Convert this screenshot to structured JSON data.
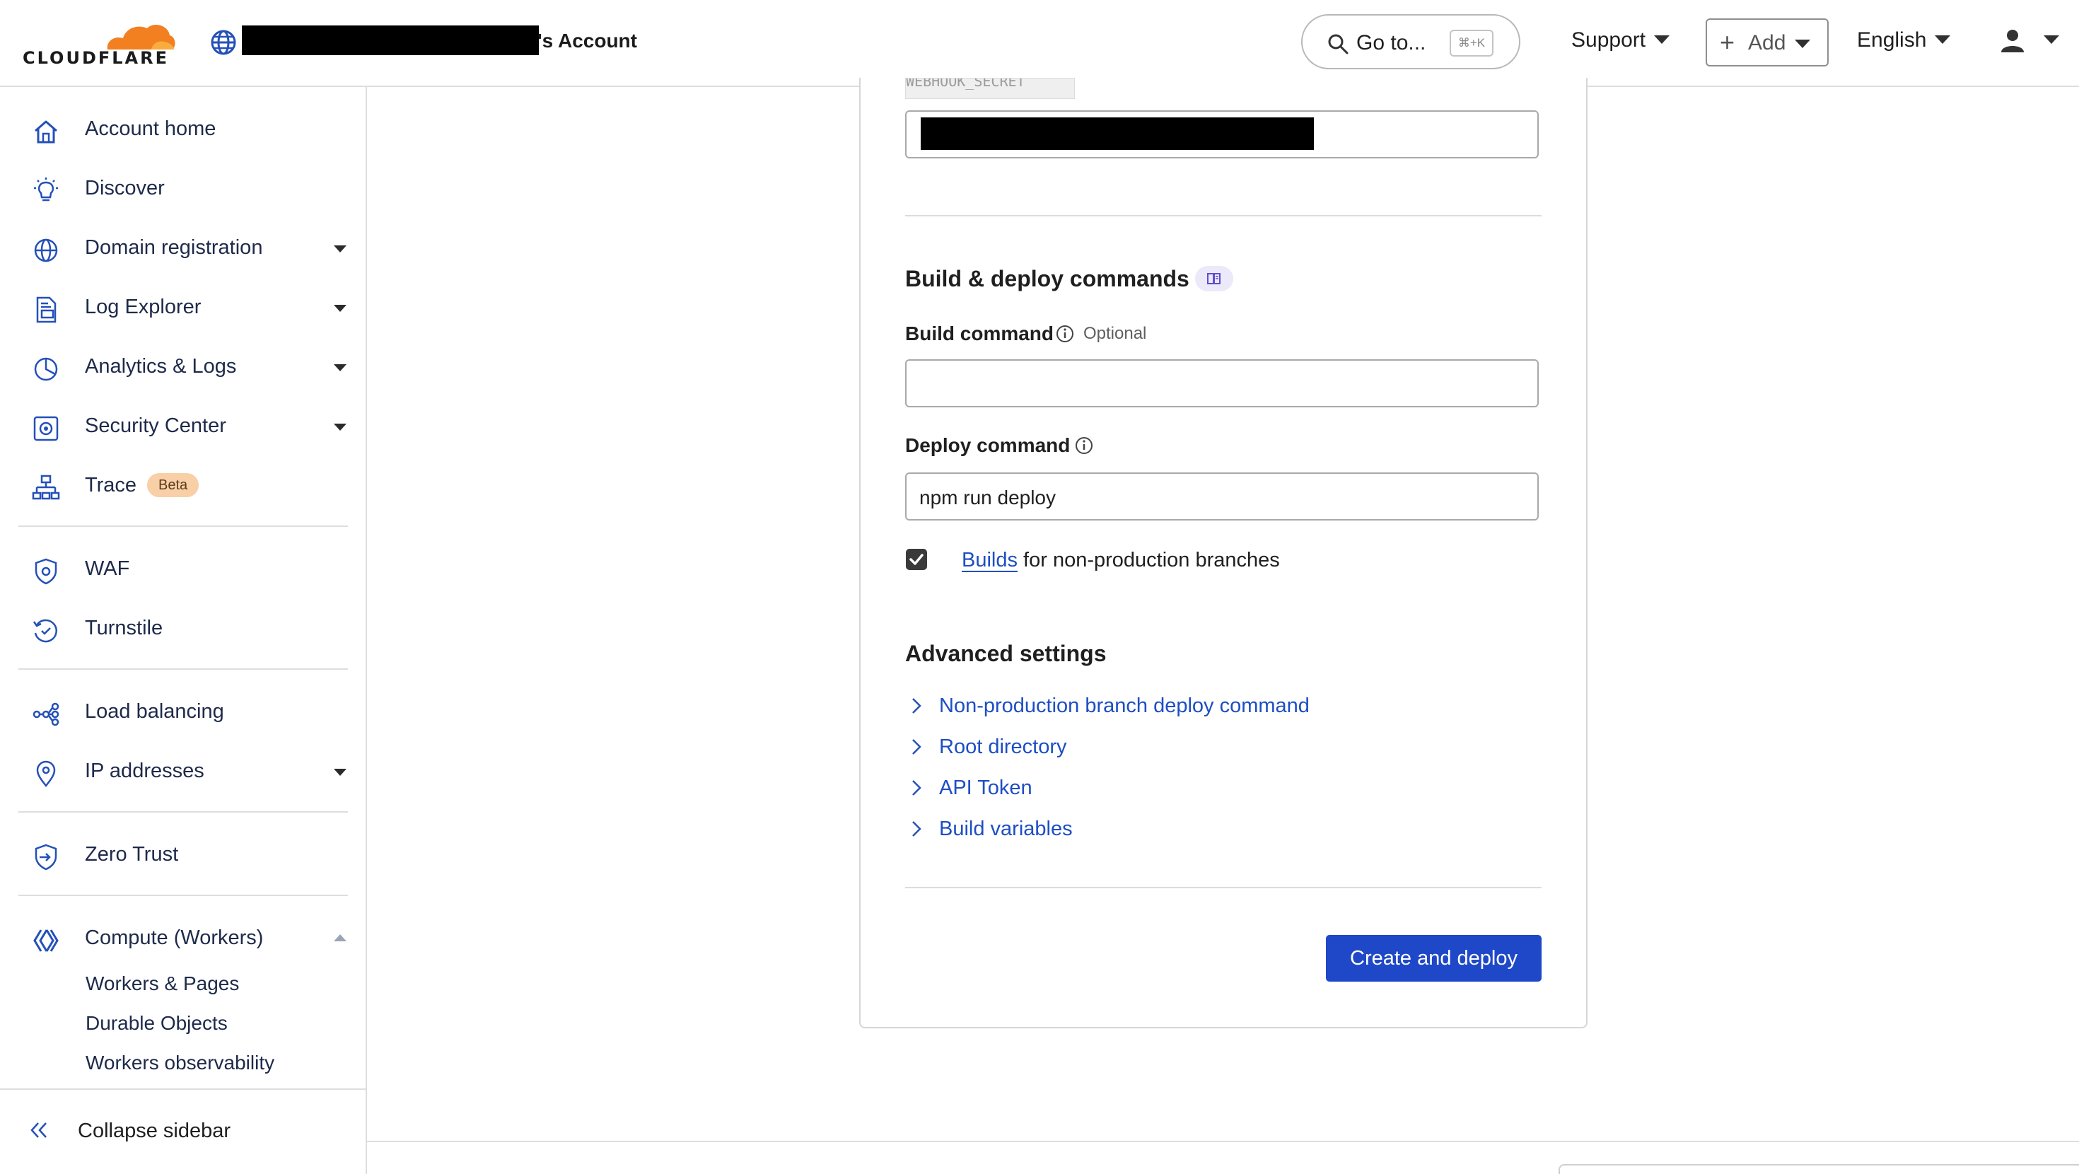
{
  "brand": {
    "logo_text": "CLOUDFLARE"
  },
  "header": {
    "account_suffix": "'s Account",
    "goto_label": "Go to...",
    "goto_shortcut": "⌘+K",
    "support_label": "Support",
    "add_label": "Add",
    "language_label": "English"
  },
  "sidebar": {
    "items": [
      {
        "label": "Account home",
        "icon": "home-icon"
      },
      {
        "label": "Discover",
        "icon": "lightbulb-icon"
      },
      {
        "label": "Domain registration",
        "icon": "globe-icon"
      },
      {
        "label": "Log Explorer",
        "icon": "log-file-icon"
      },
      {
        "label": "Analytics & Logs",
        "icon": "pie-chart-icon"
      },
      {
        "label": "Security Center",
        "icon": "security-center-icon"
      },
      {
        "label": "Trace",
        "icon": "trace-icon",
        "badge": "Beta"
      },
      {
        "label": "WAF",
        "icon": "waf-shield-icon"
      },
      {
        "label": "Turnstile",
        "icon": "turnstile-icon"
      },
      {
        "label": "Load balancing",
        "icon": "load-balancing-icon"
      },
      {
        "label": "IP addresses",
        "icon": "location-pin-icon"
      },
      {
        "label": "Zero Trust",
        "icon": "zero-trust-icon"
      },
      {
        "label": "Compute (Workers)",
        "icon": "workers-icon"
      }
    ],
    "sub_items": [
      "Workers & Pages",
      "Durable Objects",
      "Workers observability"
    ],
    "collapse_label": "Collapse sidebar"
  },
  "form": {
    "cutoff_label": "WEBHOOK_SECRET",
    "build_section_title": "Build & deploy commands",
    "build_command_label": "Build command",
    "build_command_optional": "Optional",
    "build_command_value": "",
    "deploy_command_label": "Deploy command",
    "deploy_command_value": "npm run deploy",
    "nonprod_builds_checked": true,
    "nonprod_builds_link": "Builds",
    "nonprod_builds_text": " for non-production branches",
    "advanced_title": "Advanced settings",
    "advanced_items": [
      "Non-production branch deploy command",
      "Root directory",
      "API Token",
      "Build variables"
    ],
    "submit_label": "Create and deploy"
  },
  "colors": {
    "accent_blue": "#1f48c8",
    "link_blue": "#1d4ec4",
    "cloudflare_orange": "#f38020",
    "beta_badge": "#f8cfa6"
  }
}
